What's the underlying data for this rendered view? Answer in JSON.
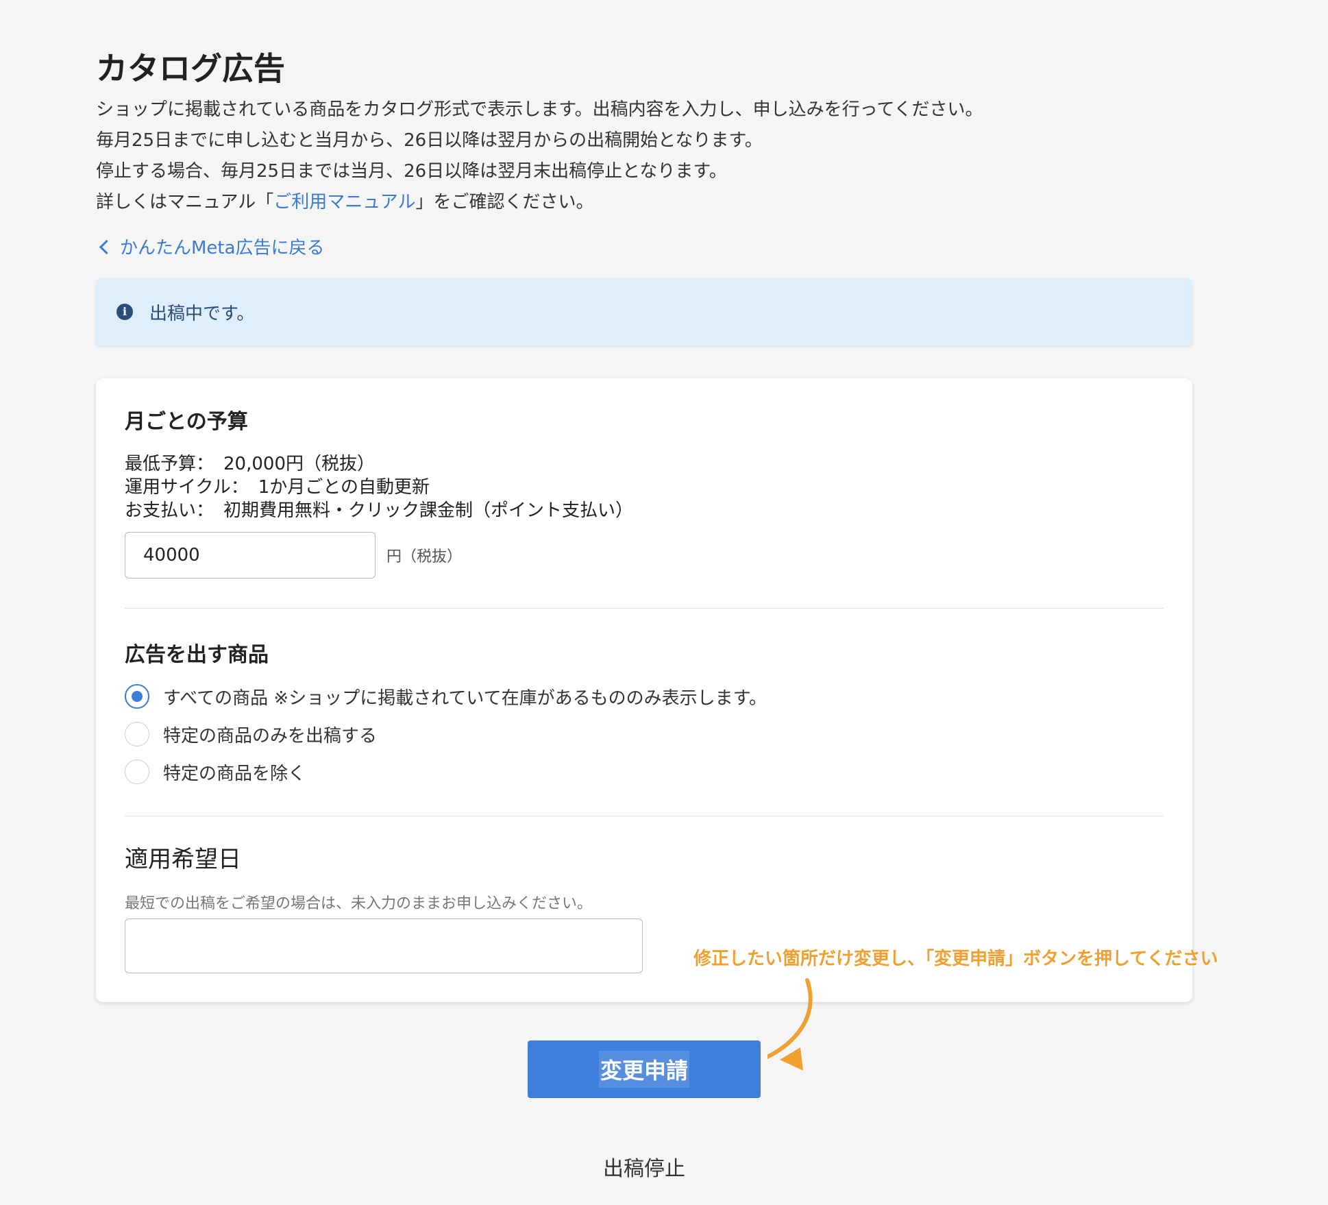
{
  "page": {
    "title": "カタログ広告",
    "intro_line1": "ショップに掲載されている商品をカタログ形式で表示します。出稿内容を入力し、申し込みを行ってください。",
    "intro_line2": "毎月25日までに申し込むと当月から、26日以降は翌月からの出稿開始となります。",
    "intro_line3": "停止する場合、毎月25日までは当月、26日以降は翌月末出稿停止となります。",
    "intro_line4_prefix": "詳しくはマニュアル「",
    "intro_line4_link": "ご利用マニュアル",
    "intro_line4_suffix": "」をご確認ください。",
    "back_link": "かんたんMeta広告に戻る"
  },
  "notice": {
    "icon": "info-icon",
    "icon_glyph": "i",
    "text": "出稿中です。"
  },
  "budget": {
    "title": "月ごとの予算",
    "min_label": "最低予算：",
    "min_value": "20,000円（税抜）",
    "cycle_label": "運用サイクル：",
    "cycle_value": "1か月ごとの自動更新",
    "payment_label": "お支払い：",
    "payment_value": "初期費用無料・クリック課金制（ポイント支払い）",
    "input_value": "40000",
    "unit": "円（税抜）"
  },
  "products": {
    "title": "広告を出す商品",
    "options": [
      {
        "label": "すべての商品 ※ショップに掲載されていて在庫があるもののみ表示します。",
        "checked": true
      },
      {
        "label": "特定の商品のみを出稿する",
        "checked": false
      },
      {
        "label": "特定の商品を除く",
        "checked": false
      }
    ]
  },
  "apply_date": {
    "title": "適用希望日",
    "hint": "最短での出稿をご希望の場合は、未入力のままお申し込みください。",
    "value": ""
  },
  "annotation": {
    "text": "修正したい箇所だけ変更し、「変更申請」ボタンを押してください",
    "color": "#f0a030"
  },
  "actions": {
    "submit_label": "変更申請",
    "stop_label": "出稿停止"
  },
  "colors": {
    "accent": "#3f7fdc",
    "link": "#3a7bd5",
    "notice_bg": "#dfeefb"
  }
}
